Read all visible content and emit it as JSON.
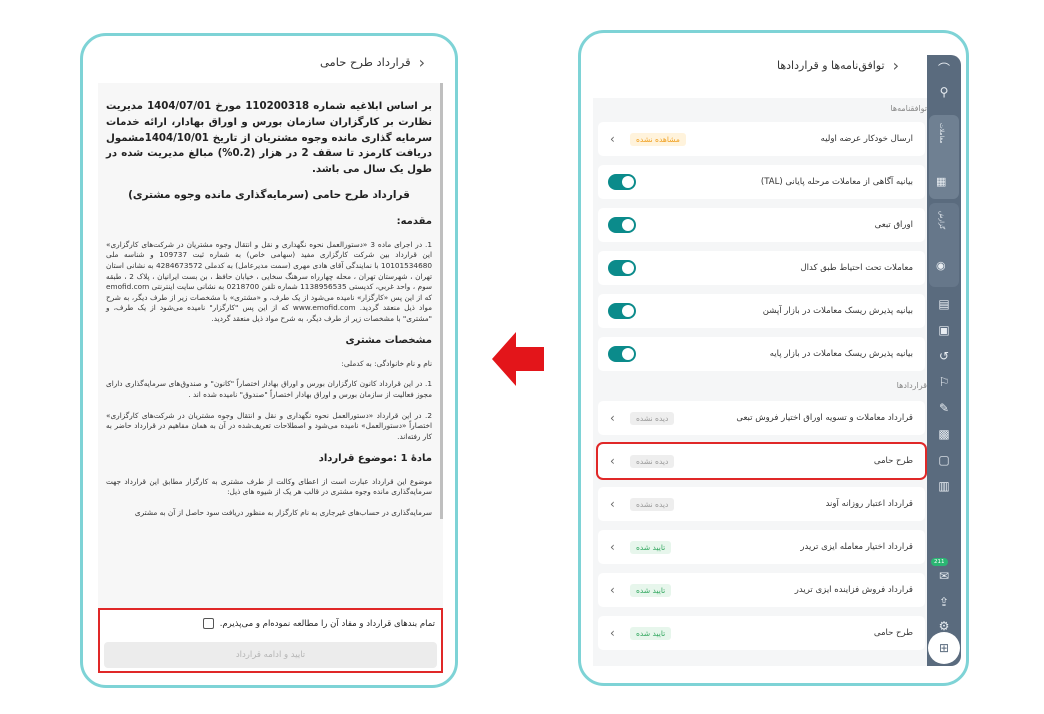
{
  "left_screen": {
    "title": "قرارداد طرح حامی",
    "intro": "بر اساس ابلاغیه شماره 110200318 مورخ 1404/07/01 مدیریت نظارت بر کارگزاران سازمان بورس و اوراق بهادار، ارائه خدمات سرمایه گذاری مانده وجوه مشتریان از تاریخ 1404/10/01مشمول دریافت کارمزد تا سقف 2 در هزار (0.2%) مبالغ مدیریت شده در طول یک سال می باشد.",
    "doc_title": "قرارداد طرح حامی (سرمایه‌گذاری مانده وجوه مشتری)",
    "h_intro": "مقدمه:",
    "p1": "1. در اجرای ماده 3 «دستورالعمل نحوه نگهداری و نقل و انتقال وجوه مشتریان در شرکت‌های کارگزاری» این قرارداد بین شرکت کارگزاری مفید (سهامی خاص) به شماره ثبت 109737 و شناسه ملی 10101534680 با نمایندگی آقای هادی مهری (سمت مدیرعامل) به کدملی 4284673572 به نشانی استان تهران ، شهرستان تهران ، محله چهارراه سرهنگ سخایی ، خیابان حافظ ، بن بست ایرانیان ، پلاک 2 ، طبقه سوم ، واحد غربي، کدپستی 1138956535 شماره تلفن 0218700 به نشانی سایت اینترنتی emofid.com که از این پس «کارگزار» نامیده می‌شود از یک طرف، و «مشتری» با مشخصات زیر از طرف دیگر، به شرح مواد ذیل منعقد گردید. www.emofid.com که از این پس \"کارگزار\" نامیده می‌شود از یک طرف، و \"مشتری\" با مشخصات زیر از طرف دیگر، به شرح مواد ذیل منعقد گردید.",
    "h_customer": "مشخصات مشتری",
    "name_line": "نام و نام خانوادگی:                 به کدملی:",
    "p2": "1. در این قرارداد کانون کارگزاران بورس و اوراق بهادار اختصاراً \"کانون\" و صندوق‌های سرمایه‌گذاری دارای مجوز فعالیت از سازمان بورس و اوراق بهادار اختصاراً \"صندوق\" نامیده شده اند .",
    "p3": "2. در این قرارداد «دستورالعمل نحوه نگهداری و نقل و انتقال وجوه مشتریان در شرکت‌های کارگزاری» اختصاراً «دستورالعمل» نامیده می‌شود و اصطلاحات تعریف‌شده در آن به همان مفاهیم در قرارداد حاضر به کار رفته‌اند.",
    "h_article1": "مادۀ 1 :موضوع قرارداد",
    "p4": "موضوع این قرارداد عبارت است از اعطای وکالت از طرف مشتری به کارگزار مطابق این قرارداد جهت سرمایه‌گذاری مانده وجوه مشتری در قالب هر یک از شیوه های ذیل:",
    "p5": "سرمایه‌گذاری در حساب‌های غیرجاری به نام کارگزار به منظور دریافت سود حاصل از آن به مشتری",
    "checkbox_label": "تمام بندهای قرارداد و مفاد آن را مطالعه نموده‌ام و می‌پذیرم.",
    "continue_label": "تایید و ادامه قرارداد"
  },
  "right_screen": {
    "title": "توافق‌نامه‌ها و قراردادها",
    "agreements_label": "توافقنامه‌ها",
    "agreements": [
      {
        "title": "ارسال خودکار عرضه اولیه",
        "badge": "مشاهده نشده"
      },
      {
        "title": "بیانیه آگاهی از معاملات مرحله پایانی (TAL)"
      },
      {
        "title": "اوراق تبعی"
      },
      {
        "title": "معاملات تحت احتیاط طبق کدال"
      },
      {
        "title": "بیانیه پذیرش ریسک معاملات در بازار آپشن"
      },
      {
        "title": "بیانیه پذیرش ریسک معاملات در بازار پایه"
      }
    ],
    "contracts_label": "قراردادها",
    "contracts": [
      {
        "title": "قرارداد معاملات و تسویه اوراق اختیار فروش تبعی",
        "badge": "دیده نشده"
      },
      {
        "title": "طرح حامی",
        "badge": "دیده نشده"
      },
      {
        "title": "قرارداد اعتبار روزانه آوند",
        "badge": "دیده نشده"
      },
      {
        "title": "قرارداد اختیار معامله ایزی تریدر",
        "badge": "تایید شده"
      },
      {
        "title": "قرارداد فروش فزاینده ایزی تریدر",
        "badge": "تایید شده"
      },
      {
        "title": "طرح حامی",
        "badge": "تایید شده"
      }
    ],
    "sidebar_badge": "211",
    "sidebar_vertical_1": "معاملات",
    "sidebar_vertical_2": "گزارش"
  },
  "colors": {
    "frame": "#7ed3d6",
    "highlight": "#e02828",
    "toggle": "#0b8b8b",
    "sidebar": "#5a6b7e",
    "arrow": "#e3151a"
  }
}
